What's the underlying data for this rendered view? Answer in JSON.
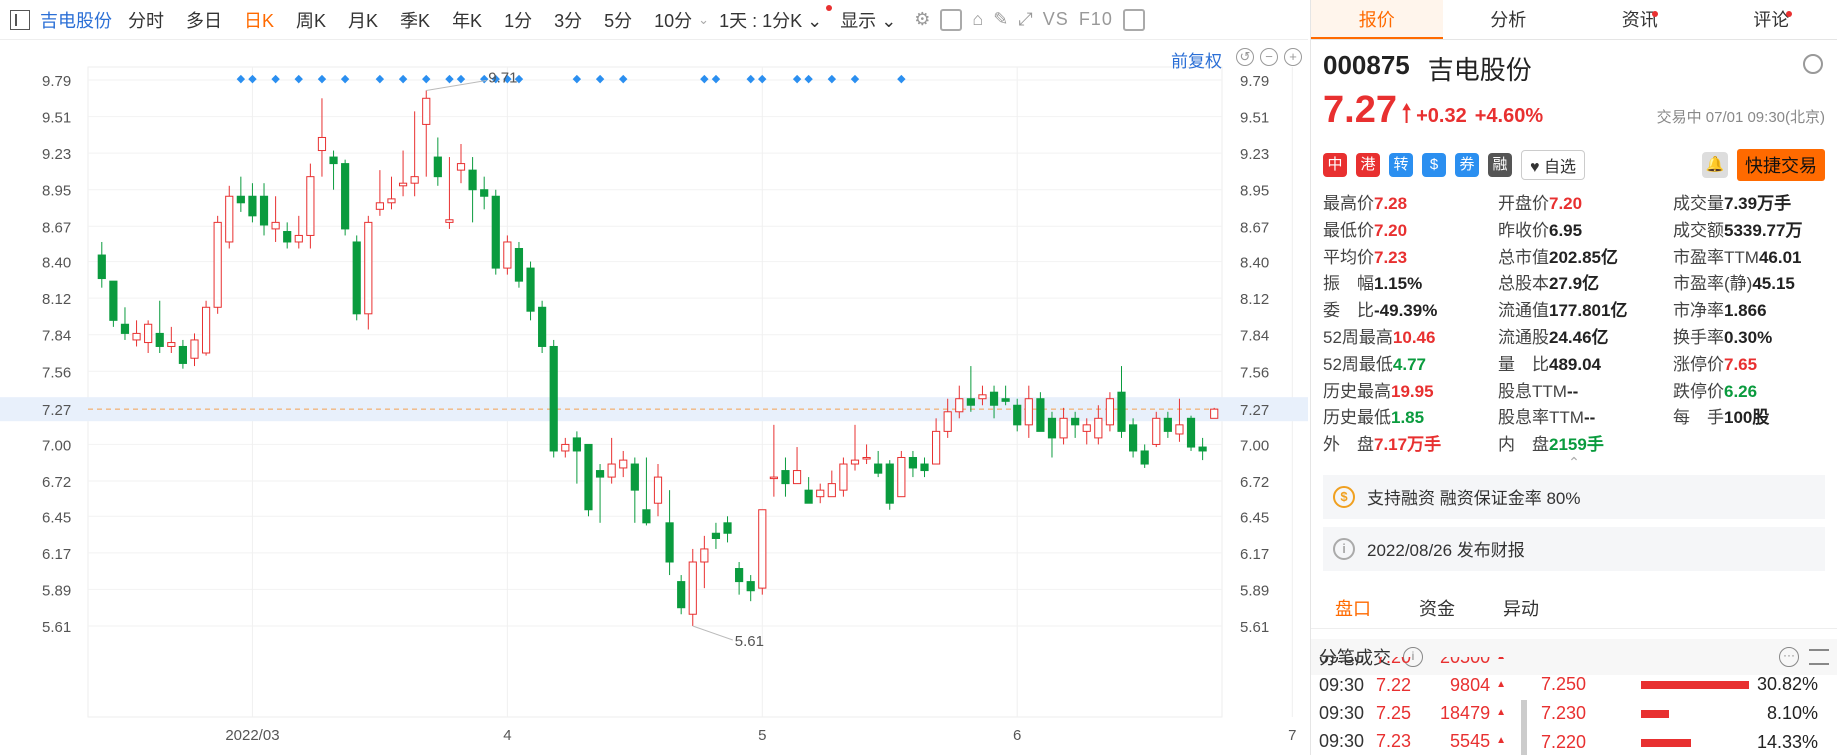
{
  "toolbar": {
    "stock_name": "吉电股份",
    "periods": [
      "分时",
      "多日",
      "日K",
      "周K",
      "月K",
      "季K",
      "年K",
      "1分",
      "3分",
      "5分",
      "10分"
    ],
    "active_period": "日K",
    "range_select": "1天 : 1分K",
    "display": "显示",
    "vs_label": "VS",
    "f10_label": "F10"
  },
  "chart": {
    "restore_label": "前复权",
    "y_ticks": [
      "9.79",
      "9.51",
      "9.23",
      "8.95",
      "8.67",
      "8.40",
      "8.12",
      "7.84",
      "7.56",
      "7.27",
      "7.00",
      "6.72",
      "6.45",
      "6.17",
      "5.89",
      "5.61"
    ],
    "x_ticks": [
      "2022/03",
      "4",
      "5",
      "6",
      "7"
    ],
    "high_label": "9.71",
    "low_label": "5.61",
    "current": "7.27",
    "colors": {
      "up": "#e83030",
      "down": "#0a9b3e",
      "marker": "#2b8ff0",
      "dashed": "#f5a050"
    }
  },
  "chart_data": {
    "type": "candlestick",
    "ylim": [
      5.5,
      9.9
    ],
    "candles": [
      [
        8.45,
        8.27,
        8.55,
        8.2
      ],
      [
        8.25,
        7.95,
        8.25,
        7.9
      ],
      [
        7.92,
        7.85,
        8.05,
        7.8
      ],
      [
        7.8,
        7.85,
        7.95,
        7.75
      ],
      [
        7.78,
        7.92,
        7.95,
        7.7
      ],
      [
        7.85,
        7.75,
        8.1,
        7.7
      ],
      [
        7.75,
        7.78,
        7.9,
        7.7
      ],
      [
        7.75,
        7.62,
        7.8,
        7.58
      ],
      [
        7.66,
        7.8,
        7.85,
        7.6
      ],
      [
        7.7,
        8.05,
        8.1,
        7.68
      ],
      [
        8.05,
        8.7,
        8.75,
        8.0
      ],
      [
        8.55,
        8.9,
        8.98,
        8.5
      ],
      [
        8.9,
        8.85,
        9.05,
        8.78
      ],
      [
        8.9,
        8.75,
        9.0,
        8.7
      ],
      [
        8.9,
        8.68,
        9.0,
        8.6
      ],
      [
        8.65,
        8.7,
        8.9,
        8.55
      ],
      [
        8.63,
        8.55,
        8.7,
        8.5
      ],
      [
        8.55,
        8.6,
        8.75,
        8.5
      ],
      [
        8.6,
        9.05,
        9.15,
        8.5
      ],
      [
        9.25,
        9.35,
        9.65,
        9.05
      ],
      [
        9.2,
        9.15,
        9.25,
        8.95
      ],
      [
        9.15,
        8.65,
        9.18,
        8.6
      ],
      [
        8.55,
        8.0,
        8.6,
        7.95
      ],
      [
        8.0,
        8.7,
        8.75,
        7.88
      ],
      [
        8.8,
        8.85,
        9.1,
        8.75
      ],
      [
        8.85,
        8.88,
        9.05,
        8.8
      ],
      [
        8.98,
        9.0,
        9.25,
        8.9
      ],
      [
        9.0,
        9.05,
        9.55,
        8.9
      ],
      [
        9.45,
        9.65,
        9.71,
        9.05
      ],
      [
        9.2,
        9.05,
        9.35,
        8.98
      ],
      [
        8.7,
        8.72,
        9.2,
        8.65
      ],
      [
        9.1,
        9.15,
        9.3,
        9.0
      ],
      [
        9.1,
        8.95,
        9.2,
        8.7
      ],
      [
        8.95,
        8.9,
        9.05,
        8.8
      ],
      [
        8.9,
        8.35,
        8.95,
        8.3
      ],
      [
        8.35,
        8.55,
        8.6,
        8.3
      ],
      [
        8.5,
        8.25,
        8.55,
        8.2
      ],
      [
        8.35,
        8.02,
        8.4,
        7.95
      ],
      [
        8.05,
        7.75,
        8.1,
        7.7
      ],
      [
        7.75,
        6.95,
        7.8,
        6.9
      ],
      [
        6.95,
        7.0,
        7.05,
        6.9
      ],
      [
        7.05,
        6.95,
        7.1,
        6.7
      ],
      [
        7.0,
        6.5,
        7.0,
        6.45
      ],
      [
        6.8,
        6.75,
        6.85,
        6.4
      ],
      [
        6.75,
        6.85,
        7.05,
        6.7
      ],
      [
        6.82,
        6.88,
        6.95,
        6.75
      ],
      [
        6.85,
        6.65,
        6.9,
        6.4
      ],
      [
        6.5,
        6.4,
        6.9,
        6.38
      ],
      [
        6.55,
        6.75,
        6.85,
        6.45
      ],
      [
        6.4,
        6.1,
        6.65,
        6.0
      ],
      [
        5.95,
        5.75,
        6.0,
        5.7
      ],
      [
        5.7,
        6.1,
        6.2,
        5.61
      ],
      [
        6.1,
        6.2,
        6.3,
        5.9
      ],
      [
        6.32,
        6.28,
        6.4,
        6.2
      ],
      [
        6.4,
        6.32,
        6.45,
        6.25
      ],
      [
        6.05,
        5.95,
        6.1,
        5.85
      ],
      [
        5.95,
        5.88,
        6.0,
        5.8
      ],
      [
        5.9,
        6.5,
        6.5,
        5.85
      ],
      [
        6.75,
        6.75,
        7.15,
        6.6
      ],
      [
        6.8,
        6.7,
        6.9,
        6.6
      ],
      [
        6.7,
        6.8,
        6.98,
        6.7
      ],
      [
        6.65,
        6.55,
        6.75,
        6.55
      ],
      [
        6.6,
        6.65,
        6.7,
        6.55
      ],
      [
        6.6,
        6.7,
        6.8,
        6.6
      ],
      [
        6.65,
        6.85,
        6.9,
        6.6
      ],
      [
        6.85,
        6.88,
        7.15,
        6.8
      ],
      [
        6.9,
        6.9,
        7.0,
        6.85
      ],
      [
        6.85,
        6.78,
        6.95,
        6.75
      ],
      [
        6.85,
        6.55,
        6.88,
        6.5
      ],
      [
        6.6,
        6.9,
        6.95,
        6.6
      ],
      [
        6.9,
        6.82,
        6.95,
        6.75
      ],
      [
        6.85,
        6.8,
        6.9,
        6.75
      ],
      [
        6.85,
        7.1,
        7.2,
        6.85
      ],
      [
        7.1,
        7.25,
        7.35,
        7.05
      ],
      [
        7.25,
        7.35,
        7.45,
        7.2
      ],
      [
        7.35,
        7.3,
        7.6,
        7.25
      ],
      [
        7.35,
        7.38,
        7.45,
        7.3
      ],
      [
        7.4,
        7.3,
        7.45,
        7.2
      ],
      [
        7.35,
        7.33,
        7.45,
        7.3
      ],
      [
        7.3,
        7.15,
        7.35,
        7.1
      ],
      [
        7.15,
        7.35,
        7.45,
        7.05
      ],
      [
        7.35,
        7.1,
        7.4,
        7.1
      ],
      [
        7.2,
        7.05,
        7.25,
        6.9
      ],
      [
        7.05,
        7.2,
        7.28,
        7.0
      ],
      [
        7.2,
        7.15,
        7.25,
        7.05
      ],
      [
        7.1,
        7.15,
        7.2,
        7.0
      ],
      [
        7.05,
        7.2,
        7.3,
        7.0
      ],
      [
        7.15,
        7.35,
        7.4,
        7.1
      ],
      [
        7.4,
        7.1,
        7.6,
        7.05
      ],
      [
        7.15,
        6.95,
        7.2,
        6.9
      ],
      [
        6.95,
        6.85,
        7.0,
        6.82
      ],
      [
        7.0,
        7.2,
        7.25,
        6.98
      ],
      [
        7.2,
        7.1,
        7.25,
        7.05
      ],
      [
        7.08,
        7.15,
        7.35,
        7.02
      ],
      [
        7.2,
        6.98,
        7.22,
        6.95
      ],
      [
        6.98,
        6.95,
        7.05,
        6.88
      ],
      [
        7.2,
        7.27,
        7.28,
        7.2
      ]
    ],
    "markers_x_index": [
      12,
      13,
      15,
      17,
      19,
      21,
      24,
      26,
      28,
      30,
      31,
      33,
      34,
      35,
      36,
      41,
      43,
      45,
      52,
      53,
      56,
      57,
      60,
      61,
      63,
      65,
      69
    ]
  },
  "quote": {
    "code": "000875",
    "name": "吉电股份",
    "price": "7.27",
    "change": "+0.32",
    "pct": "+4.60%",
    "status": "交易中 07/01 09:30(北京)",
    "fav": "自选",
    "quick_trade": "快捷交易",
    "badges": [
      "中",
      "港",
      "转",
      "$",
      "券",
      "融"
    ],
    "badge_colors": [
      "#e83030",
      "#e83030",
      "#2b8ff0",
      "#2b8ff0",
      "#2b8ff0",
      "#555"
    ]
  },
  "tabs": [
    "报价",
    "分析",
    "资讯",
    "评论"
  ],
  "stats": [
    {
      "k": "最高价",
      "v": "7.28",
      "c": "up"
    },
    {
      "k": "开盘价",
      "v": "7.20",
      "c": "up"
    },
    {
      "k": "成交量",
      "v": "7.39万手",
      "c": ""
    },
    {
      "k": "最低价",
      "v": "7.20",
      "c": "up"
    },
    {
      "k": "昨收价",
      "v": "6.95",
      "c": ""
    },
    {
      "k": "成交额",
      "v": "5339.77万",
      "c": ""
    },
    {
      "k": "平均价",
      "v": "7.23",
      "c": "up"
    },
    {
      "k": "总市值",
      "v": "202.85亿",
      "c": ""
    },
    {
      "k": "市盈率TTM",
      "v": "46.01",
      "c": ""
    },
    {
      "k": "振　幅",
      "v": "1.15%",
      "c": ""
    },
    {
      "k": "总股本",
      "v": "27.9亿",
      "c": ""
    },
    {
      "k": "市盈率(静)",
      "v": "45.15",
      "c": ""
    },
    {
      "k": "委　比",
      "v": "-49.39%",
      "c": ""
    },
    {
      "k": "流通值",
      "v": "177.801亿",
      "c": ""
    },
    {
      "k": "市净率",
      "v": "1.866",
      "c": ""
    },
    {
      "k": "52周最高",
      "v": "10.46",
      "c": "up"
    },
    {
      "k": "流通股",
      "v": "24.46亿",
      "c": ""
    },
    {
      "k": "换手率",
      "v": "0.30%",
      "c": ""
    },
    {
      "k": "52周最低",
      "v": "4.77",
      "c": "down"
    },
    {
      "k": "量　比",
      "v": "489.04",
      "c": ""
    },
    {
      "k": "涨停价",
      "v": "7.65",
      "c": "up"
    },
    {
      "k": "历史最高",
      "v": "19.95",
      "c": "up"
    },
    {
      "k": "股息TTM",
      "v": "--",
      "c": ""
    },
    {
      "k": "跌停价",
      "v": "6.26",
      "c": "down"
    },
    {
      "k": "历史最低",
      "v": "1.85",
      "c": "down"
    },
    {
      "k": "股息率TTM",
      "v": "--",
      "c": ""
    },
    {
      "k": "每　手",
      "v": "100股",
      "c": ""
    },
    {
      "k": "外　盘",
      "v": "7.17万手",
      "c": "up"
    },
    {
      "k": "内　盘",
      "v": "2159手",
      "c": "down"
    },
    {
      "k": "",
      "v": "",
      "c": ""
    }
  ],
  "notices": [
    "支持融资 融资保证金率 80%",
    "2022/08/26  发布财报"
  ],
  "subtabs": [
    "盘口",
    "资金",
    "异动"
  ],
  "fenbi_title": "分笔成交",
  "trades": [
    {
      "t": "09:30",
      "p": "7.20",
      "q": "20500"
    },
    {
      "t": "09:30",
      "p": "7.22",
      "q": "9804"
    },
    {
      "t": "09:30",
      "p": "7.25",
      "q": "18479"
    },
    {
      "t": "09:30",
      "p": "7.23",
      "q": "5545"
    }
  ],
  "distribution": [
    {
      "p": "7.250",
      "pct": "30.82%",
      "w": 0.308
    },
    {
      "p": "7.230",
      "pct": "8.10%",
      "w": 0.081
    },
    {
      "p": "7.220",
      "pct": "14.33%",
      "w": 0.143
    }
  ]
}
